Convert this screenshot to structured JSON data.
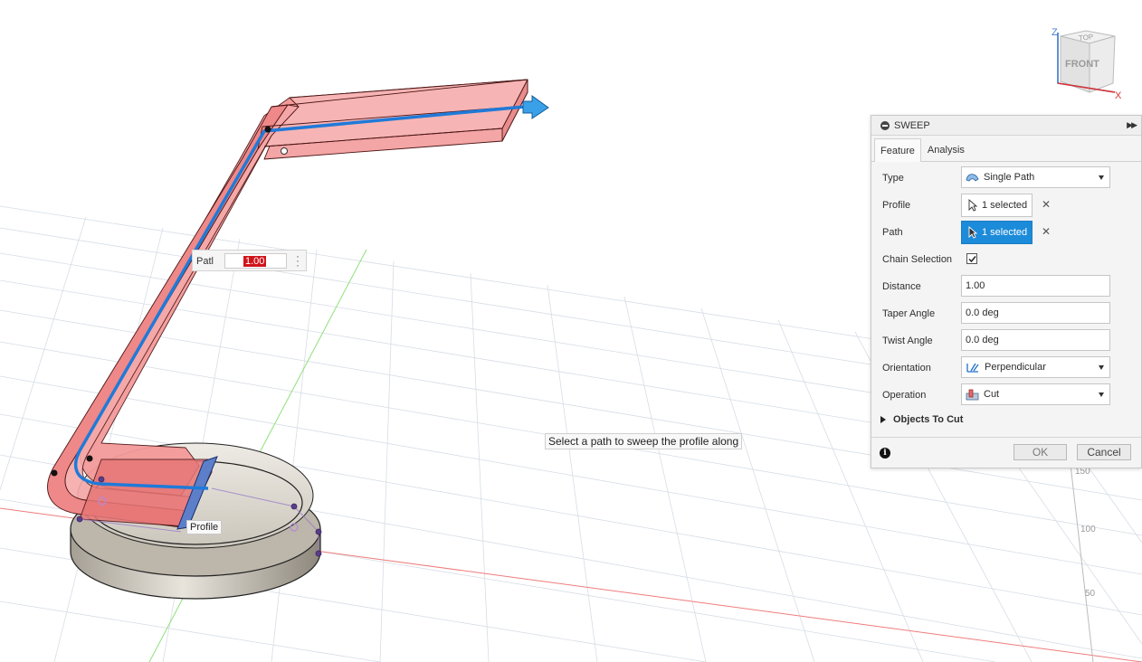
{
  "panel": {
    "title": "SWEEP",
    "tabs": [
      {
        "label": "Feature",
        "active": true
      },
      {
        "label": "Analysis",
        "active": false
      }
    ],
    "rows": {
      "type": {
        "label": "Type",
        "value": "Single Path",
        "icon": "single-path-icon"
      },
      "profile": {
        "label": "Profile",
        "value": "1 selected",
        "icon": "select-arrow-icon"
      },
      "path": {
        "label": "Path",
        "value": "1 selected",
        "icon": "select-arrow-icon",
        "active": true
      },
      "chain_selection": {
        "label": "Chain Selection",
        "checked": true
      },
      "distance": {
        "label": "Distance",
        "value": "1.00"
      },
      "taper_angle": {
        "label": "Taper Angle",
        "value": "0.0 deg"
      },
      "twist_angle": {
        "label": "Twist Angle",
        "value": "0.0 deg"
      },
      "orientation": {
        "label": "Orientation",
        "value": "Perpendicular",
        "icon": "perpendicular-icon"
      },
      "operation": {
        "label": "Operation",
        "value": "Cut",
        "icon": "cut-icon"
      }
    },
    "objects_to_cut": "Objects To Cut",
    "ok_label": "OK",
    "cancel_label": "Cancel"
  },
  "viewport": {
    "hint": "Select a path to sweep the profile along",
    "manipulator_label": "Patl",
    "manipulator_value": "1.00",
    "profile_tag": "Profile",
    "ruler_labels": [
      "150",
      "100",
      "50"
    ],
    "viewcube": {
      "top": "TOP",
      "front": "FRONT",
      "z_axis": "Z",
      "x_axis": "X"
    }
  },
  "colors": {
    "accent": "#1c8bd9",
    "path_blue": "#1f7ad8",
    "sweep_red": "#f08080",
    "value_red": "#d0141b"
  }
}
